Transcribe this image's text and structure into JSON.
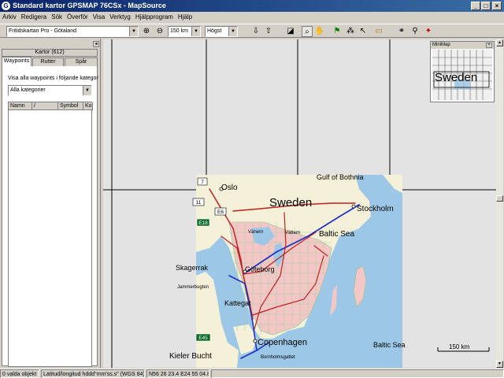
{
  "window": {
    "title": "Standard kartor GPSMAP 76CSx - MapSource"
  },
  "menu": [
    "Arkiv",
    "Redigera",
    "Sök",
    "Överför",
    "Visa",
    "Verktyg",
    "Hjälpprogram",
    "Hjälp"
  ],
  "toolbar": {
    "map_product": "Fritidskartan Pro - Götaland",
    "zoom_scale": "150 km",
    "detail_level": "Högst"
  },
  "left_panel": {
    "maps_tab": "Kartor (612)",
    "tabs": [
      "Waypoints",
      "Rutter",
      "Spår"
    ],
    "filter_label": "Visa alla waypoints i följande kategor",
    "category_select": "Alla kategorier",
    "columns": [
      "Namn",
      "/",
      "Symbol",
      "Ko"
    ]
  },
  "minimap": {
    "title": "MiniMap",
    "label": "Sweden"
  },
  "map": {
    "labels": {
      "gulf_of_bothnia": "Gulf of Bothnia",
      "oslo": "Oslo",
      "sweden": "Sweden",
      "stockholm": "Stockholm",
      "vanern": "Vänern",
      "vattern": "Vättern",
      "baltic_sea_north": "Baltic Sea",
      "skagerrak": "Skagerrak",
      "jammerbugten": "Jammerbugten",
      "goteborg": "Göteborg",
      "kattegat": "Kattegat",
      "copenhagen": "Copenhagen",
      "baltic_sea_south": "Baltic Sea",
      "kieler_bucht": "Kieler Bucht",
      "bornholm": "Bornholmsgattet"
    },
    "shields": {
      "e7": "7",
      "e11": "11",
      "e6": "E6",
      "e18": "E18",
      "e45": "E45"
    },
    "scale_bar": "150 km"
  },
  "status": {
    "selected": "0 valda objekt",
    "coord_format": "Latitud/longitud hddd°mm'ss.s\" (WGS 84)",
    "coords": "N56 26 23.4 E24 55 04.8"
  }
}
